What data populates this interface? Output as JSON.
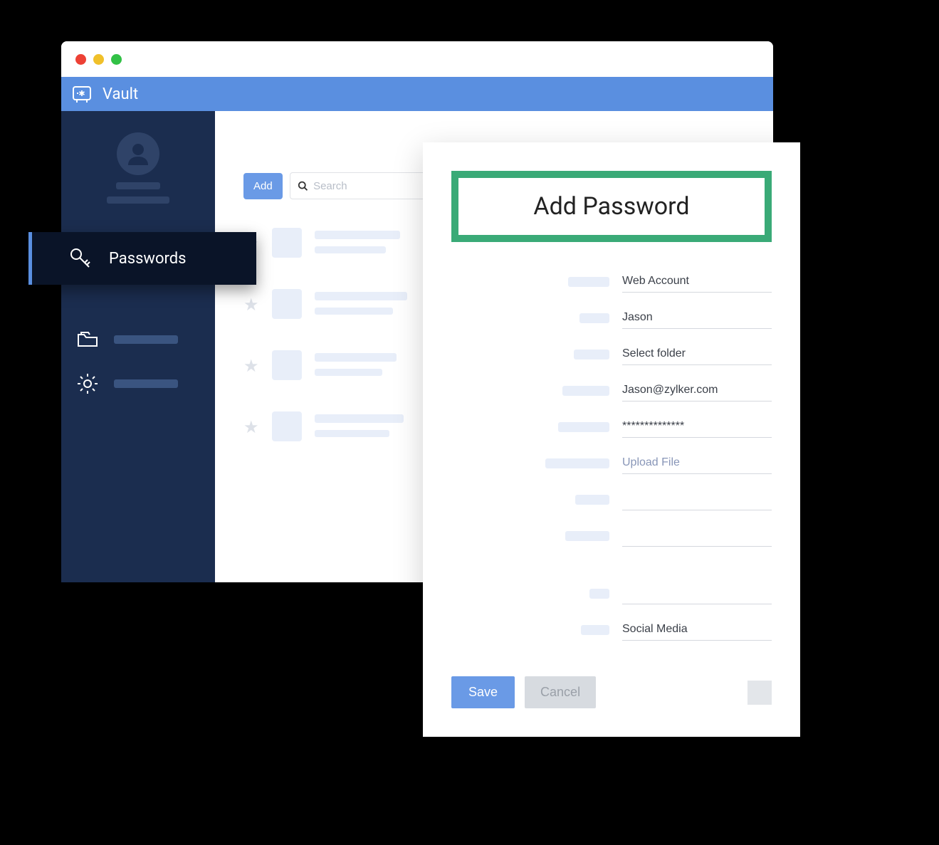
{
  "app": {
    "title": "Vault"
  },
  "sidebar": {
    "active_label": "Passwords"
  },
  "toolbar": {
    "add_label": "Add",
    "search_placeholder": "Search"
  },
  "panel": {
    "title": "Add Password",
    "fields": {
      "account_type": "Web Account",
      "name": "Jason",
      "folder": "Select folder",
      "email": "Jason@zylker.com",
      "password": "**************",
      "file": "Upload File",
      "blank1": "",
      "blank2": "",
      "blank3": "",
      "category": "Social Media"
    },
    "save_label": "Save",
    "cancel_label": "Cancel"
  }
}
